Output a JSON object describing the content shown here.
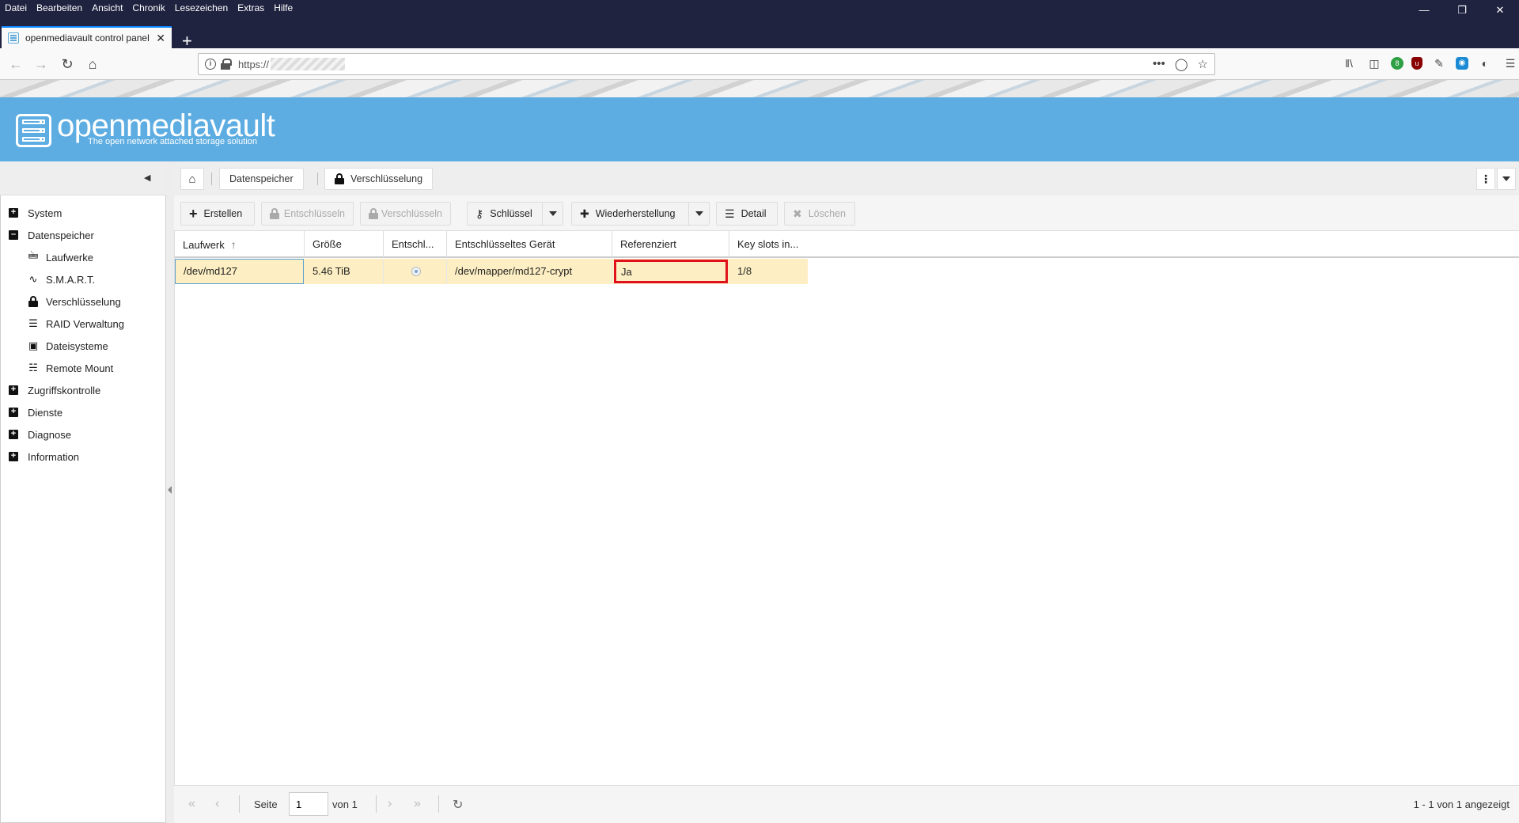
{
  "browser": {
    "menu": [
      "Datei",
      "Bearbeiten",
      "Ansicht",
      "Chronik",
      "Lesezeichen",
      "Extras",
      "Hilfe"
    ],
    "tab_title": "openmediavault control panel",
    "url": "https://"
  },
  "app": {
    "title": "openmediavault",
    "subtitle": "The open network attached storage solution"
  },
  "nav": {
    "system": "System",
    "datenspeicher": "Datenspeicher",
    "children": [
      "Laufwerke",
      "S.M.A.R.T.",
      "Verschlüsselung",
      "RAID Verwaltung",
      "Dateisysteme",
      "Remote Mount"
    ],
    "zugriff": "Zugriffskontrolle",
    "dienste": "Dienste",
    "diagnose": "Diagnose",
    "information": "Information"
  },
  "breadcrumb": {
    "level1": "Datenspeicher",
    "level2": "Verschlüsselung"
  },
  "toolbar": {
    "create": "Erstellen",
    "unlock": "Entschlüsseln",
    "lock": "Verschlüsseln",
    "key": "Schlüssel",
    "restore": "Wiederherstellung",
    "detail": "Detail",
    "delete": "Löschen"
  },
  "grid": {
    "columns": [
      "Laufwerk",
      "Größe",
      "Entschl...",
      "Entschlüsseltes Gerät",
      "Referenziert",
      "Key slots in..."
    ],
    "rows": [
      {
        "device": "/dev/md127",
        "size": "5.46 TiB",
        "unlocked": true,
        "decrypted_device": "/dev/mapper/md127-crypt",
        "referenced": "Ja",
        "key_slots": "1/8"
      }
    ]
  },
  "pager": {
    "page_label": "Seite",
    "page_value": "1",
    "of_label": "von 1",
    "summary": "1 - 1 von 1 angezeigt"
  },
  "colors": {
    "header": "#5dade2",
    "selected_row": "#fdefc3",
    "highlight_border": "#e0111a",
    "browser_frame": "#202340"
  }
}
